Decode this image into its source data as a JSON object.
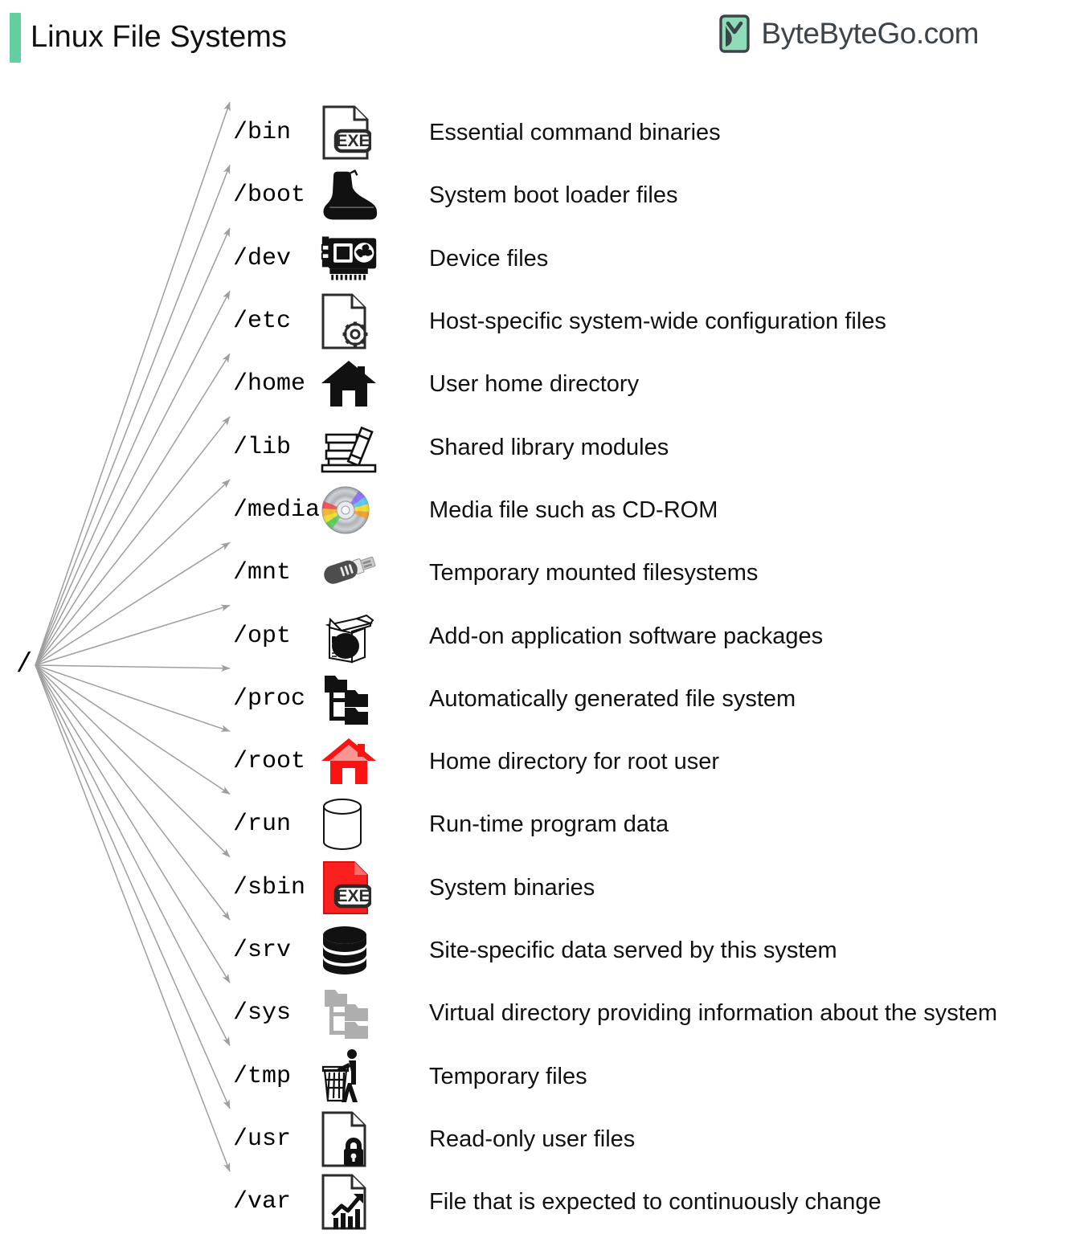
{
  "header": {
    "title": "Linux File Systems",
    "accent_color": "#63cfa0",
    "brand": {
      "name": "ByteByteGo.com",
      "logo_icon": "bytebytego-logo-icon"
    }
  },
  "tree": {
    "root_label": "/",
    "arrow_color": "#9a9a9a"
  },
  "rows": [
    {
      "path": "/bin",
      "icon": "exe-file-icon",
      "desc": "Essential command binaries"
    },
    {
      "path": "/boot",
      "icon": "boot-icon",
      "desc": "System boot loader files"
    },
    {
      "path": "/dev",
      "icon": "expansion-card-icon",
      "desc": "Device files"
    },
    {
      "path": "/etc",
      "icon": "file-gear-icon",
      "desc": "Host-specific system-wide configuration files"
    },
    {
      "path": "/home",
      "icon": "house-icon",
      "desc": "User home directory"
    },
    {
      "path": "/lib",
      "icon": "books-icon",
      "desc": "Shared library modules"
    },
    {
      "path": "/media",
      "icon": "cd-disc-icon",
      "desc": "Media file such as CD-ROM"
    },
    {
      "path": "/mnt",
      "icon": "usb-drive-icon",
      "desc": "Temporary mounted filesystems"
    },
    {
      "path": "/opt",
      "icon": "open-box-icon",
      "desc": "Add-on application software packages"
    },
    {
      "path": "/proc",
      "icon": "folder-tree-icon",
      "desc": "Automatically generated file system"
    },
    {
      "path": "/root",
      "icon": "red-house-icon",
      "desc": "Home directory for root user"
    },
    {
      "path": "/run",
      "icon": "cylinder-icon",
      "desc": "Run-time program data"
    },
    {
      "path": "/sbin",
      "icon": "red-exe-file-icon",
      "desc": "System binaries"
    },
    {
      "path": "/srv",
      "icon": "database-stack-icon",
      "desc": "Site-specific data served by this system"
    },
    {
      "path": "/sys",
      "icon": "grey-folder-tree-icon",
      "desc": "Virtual directory providing information about the system"
    },
    {
      "path": "/tmp",
      "icon": "trash-person-icon",
      "desc": "Temporary files"
    },
    {
      "path": "/usr",
      "icon": "file-lock-icon",
      "desc": "Read-only user files"
    },
    {
      "path": "/var",
      "icon": "file-chart-icon",
      "desc": "File that is expected to continuously change"
    }
  ]
}
